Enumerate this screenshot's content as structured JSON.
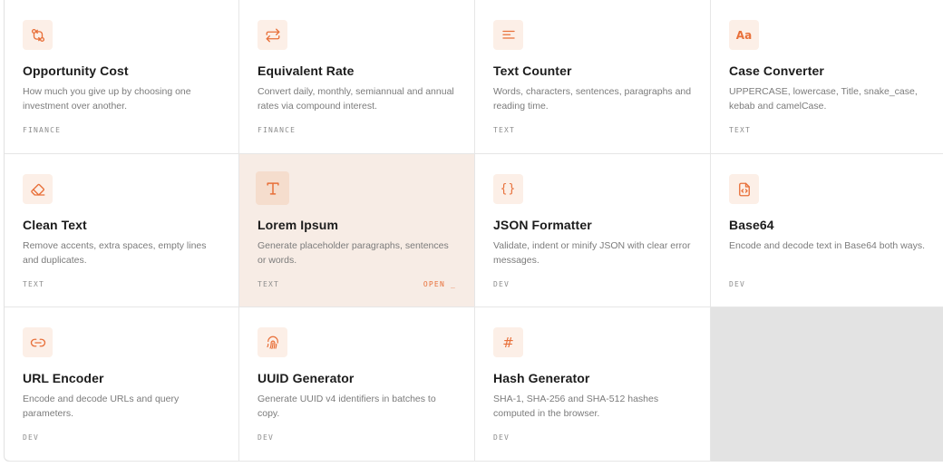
{
  "accent": "#e8703a",
  "cards": [
    {
      "title": "Opportunity Cost",
      "desc": "How much you give up by choosing one investment over another.",
      "tag": "FINANCE",
      "icon": "compare-arrows-icon"
    },
    {
      "title": "Equivalent Rate",
      "desc": "Convert daily, monthly, semiannual and annual rates via compound interest.",
      "tag": "FINANCE",
      "icon": "swap-arrows-icon"
    },
    {
      "title": "Text Counter",
      "desc": "Words, characters, sentences, paragraphs and reading time.",
      "tag": "TEXT",
      "icon": "text-lines-icon"
    },
    {
      "title": "Case Converter",
      "desc": "UPPERCASE, lowercase, Title, snake_case, kebab and camelCase.",
      "tag": "TEXT",
      "icon": "letter-case-icon",
      "icon_text": "Aa"
    },
    {
      "title": "Clean Text",
      "desc": "Remove accents, extra spaces, empty lines and duplicates.",
      "tag": "TEXT",
      "icon": "eraser-icon"
    },
    {
      "title": "Lorem Ipsum",
      "desc": "Generate placeholder paragraphs, sentences or words.",
      "tag": "TEXT",
      "icon": "type-t-icon",
      "open_label": "OPEN _"
    },
    {
      "title": "JSON Formatter",
      "desc": "Validate, indent or minify JSON with clear error messages.",
      "tag": "DEV",
      "icon": "braces-icon",
      "icon_text": "{}"
    },
    {
      "title": "Base64",
      "desc": "Encode and decode text in Base64 both ways.",
      "tag": "DEV",
      "icon": "file-code-icon"
    },
    {
      "title": "URL Encoder",
      "desc": "Encode and decode URLs and query parameters.",
      "tag": "DEV",
      "icon": "link-icon"
    },
    {
      "title": "UUID Generator",
      "desc": "Generate UUID v4 identifiers in batches to copy.",
      "tag": "DEV",
      "icon": "fingerprint-icon"
    },
    {
      "title": "Hash Generator",
      "desc": "SHA-1, SHA-256 and SHA-512 hashes computed in the browser.",
      "tag": "DEV",
      "icon": "hash-icon",
      "icon_text": "#"
    }
  ]
}
